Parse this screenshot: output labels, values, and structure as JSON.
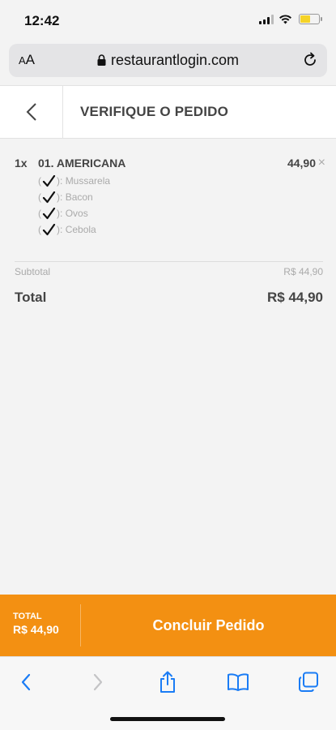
{
  "status_bar": {
    "time": "12:42"
  },
  "browser": {
    "aa_label_small": "A",
    "aa_label_large": "A",
    "url": "restaurantlogin.com"
  },
  "header": {
    "title": "VERIFIQUE O PEDIDO"
  },
  "order": {
    "item": {
      "quantity": "1x",
      "name": "01. AMERICANA",
      "price": "44,90",
      "remove_glyph": "×",
      "options": [
        {
          "open": "(",
          "close": "):",
          "label": "Mussarela"
        },
        {
          "open": "(",
          "close": "):",
          "label": "Bacon"
        },
        {
          "open": "(",
          "close": "):",
          "label": "Ovos"
        },
        {
          "open": "(",
          "close": "):",
          "label": "Cebola"
        }
      ]
    },
    "subtotal_label": "Subtotal",
    "subtotal_value": "R$ 44,90",
    "total_label": "Total",
    "total_value": "R$ 44,90"
  },
  "checkout": {
    "total_label": "TOTAL",
    "total_value": "R$ 44,90",
    "button_label": "Concluir Pedido"
  },
  "colors": {
    "accent": "#f39012",
    "ios_blue": "#1a7cf5",
    "battery": "#f5d327"
  }
}
